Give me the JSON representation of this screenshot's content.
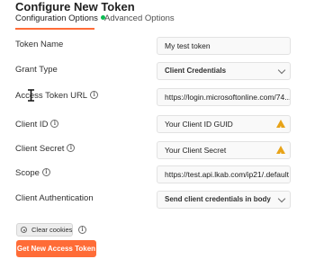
{
  "header": {
    "title": "Configure New Token"
  },
  "tabs": [
    {
      "label": "Configuration Options",
      "active": true
    },
    {
      "label": "Advanced Options",
      "active": false
    }
  ],
  "form": {
    "token_name": {
      "label": "Token Name",
      "value": "My test token"
    },
    "grant_type": {
      "label": "Grant Type",
      "value": "Client Credentials"
    },
    "access_token_url": {
      "label": "Access Token URL",
      "value": "https://login.microsoftonline.com/74..."
    },
    "client_id": {
      "label": "Client ID",
      "value": "Your Client ID GUID"
    },
    "client_secret": {
      "label": "Client Secret",
      "value": "Your Client Secret"
    },
    "scope": {
      "label": "Scope",
      "value": "https://test.api.lkab.com/ip21/.default"
    },
    "client_auth": {
      "label": "Client Authentication",
      "value": "Send client credentials in body"
    }
  },
  "actions": {
    "clear_cookies": "Clear cookies",
    "get_token": "Get New Access Token"
  },
  "colors": {
    "accent": "#ff6c37",
    "success": "#0cbb52",
    "warning": "#e8a317"
  }
}
